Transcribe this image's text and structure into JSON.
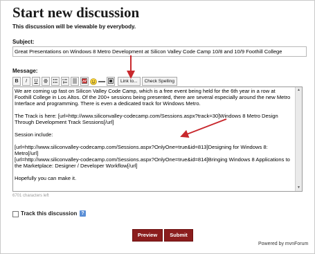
{
  "page": {
    "title": "Start new discussion",
    "subtitle": "This discussion will be viewable by everybody."
  },
  "subject": {
    "label": "Subject:",
    "value": "Great Presentations on Windows 8 Metro Development at Silicon Valley Code Camp 10/8 and 10/9 Foothill College"
  },
  "message": {
    "label": "Message:",
    "toolbar": {
      "bold": "B",
      "italic": "I",
      "underline": "U",
      "link_label": "Link to...",
      "spell_label": "Check Spelling",
      "icons": [
        "strikethrough-icon",
        "bullet-list-icon",
        "numbered-list-icon",
        "quote-icon",
        "image-icon",
        "smiley-icon",
        "horizontal-rule-icon",
        "media-icon"
      ]
    },
    "paragraphs": [
      "We are coming up fast on Silicon Valley Code Camp, which is a free event being held for the 6th year in a row at Foothill College in Los Altos. Of the 200+ sessions being presented, there are several especially around the new Metro Interface and programming.  There is even a dedicated track for Windows Metro.",
      "The Track is here:  [url=http://www.siliconvalley-codecamp.com/Sessions.aspx?track=30]Windows 8 Metro Design Through Development Track Sessions[/url]",
      "Session include:",
      "[url=http://www.siliconvalley-codecamp.com/Sessions.aspx?OnlyOne=true&id=813]Designing for Windows 8: Metro[/url]\n[url=http://www.siliconvalley-codecamp.com/Sessions.aspx?OnlyOne=true&id=814]Bringing Windows 8 Applications to the Marketplace: Designer / Developer Workflow[/url]",
      "Hopefully you can make it."
    ],
    "counter": "6701 characters left"
  },
  "track": {
    "label": "Track this discussion",
    "checked": false,
    "help": "?"
  },
  "buttons": {
    "preview": "Preview",
    "submit": "Submit"
  },
  "footer": {
    "powered_by": "Powered by  mvnForum"
  },
  "colors": {
    "button_bg": "#8b1d1d",
    "annotation_arrow": "#c8282d",
    "help_icon": "#5b8fd6"
  }
}
